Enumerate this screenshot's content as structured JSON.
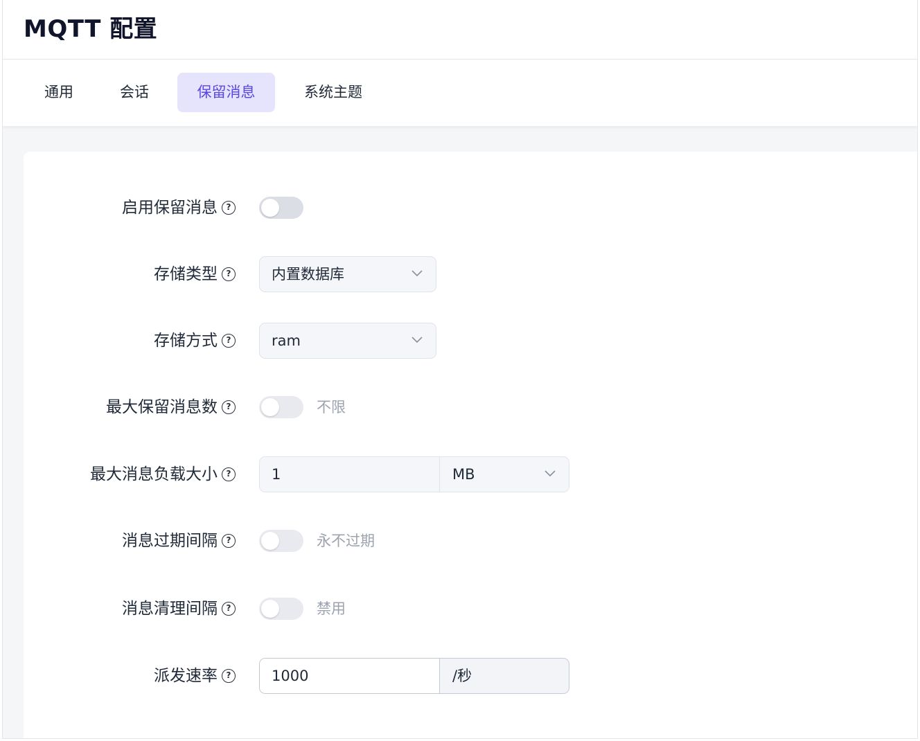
{
  "page": {
    "title": "MQTT 配置"
  },
  "tabs": [
    {
      "label": "通用",
      "active": false
    },
    {
      "label": "会话",
      "active": false
    },
    {
      "label": "保留消息",
      "active": true
    },
    {
      "label": "系统主题",
      "active": false
    }
  ],
  "colors": {
    "accent": "#5a48e0",
    "tab_active_bg": "#e6e4fd",
    "muted_text": "#9ca3af"
  },
  "form": {
    "help_icon": "?",
    "enable_retained": {
      "label": "启用保留消息",
      "checked": false
    },
    "storage_type": {
      "label": "存储类型",
      "value": "内置数据库"
    },
    "storage_method": {
      "label": "存储方式",
      "value": "ram"
    },
    "max_retained": {
      "label": "最大保留消息数",
      "checked": false,
      "text": "不限"
    },
    "max_payload": {
      "label": "最大消息负载大小",
      "value": "1",
      "unit": "MB"
    },
    "expiry_interval": {
      "label": "消息过期间隔",
      "checked": false,
      "text": "永不过期"
    },
    "clean_interval": {
      "label": "消息清理间隔",
      "checked": false,
      "text": "禁用"
    },
    "dispatch_rate": {
      "label": "派发速率",
      "value": "1000",
      "unit": "/秒"
    }
  }
}
